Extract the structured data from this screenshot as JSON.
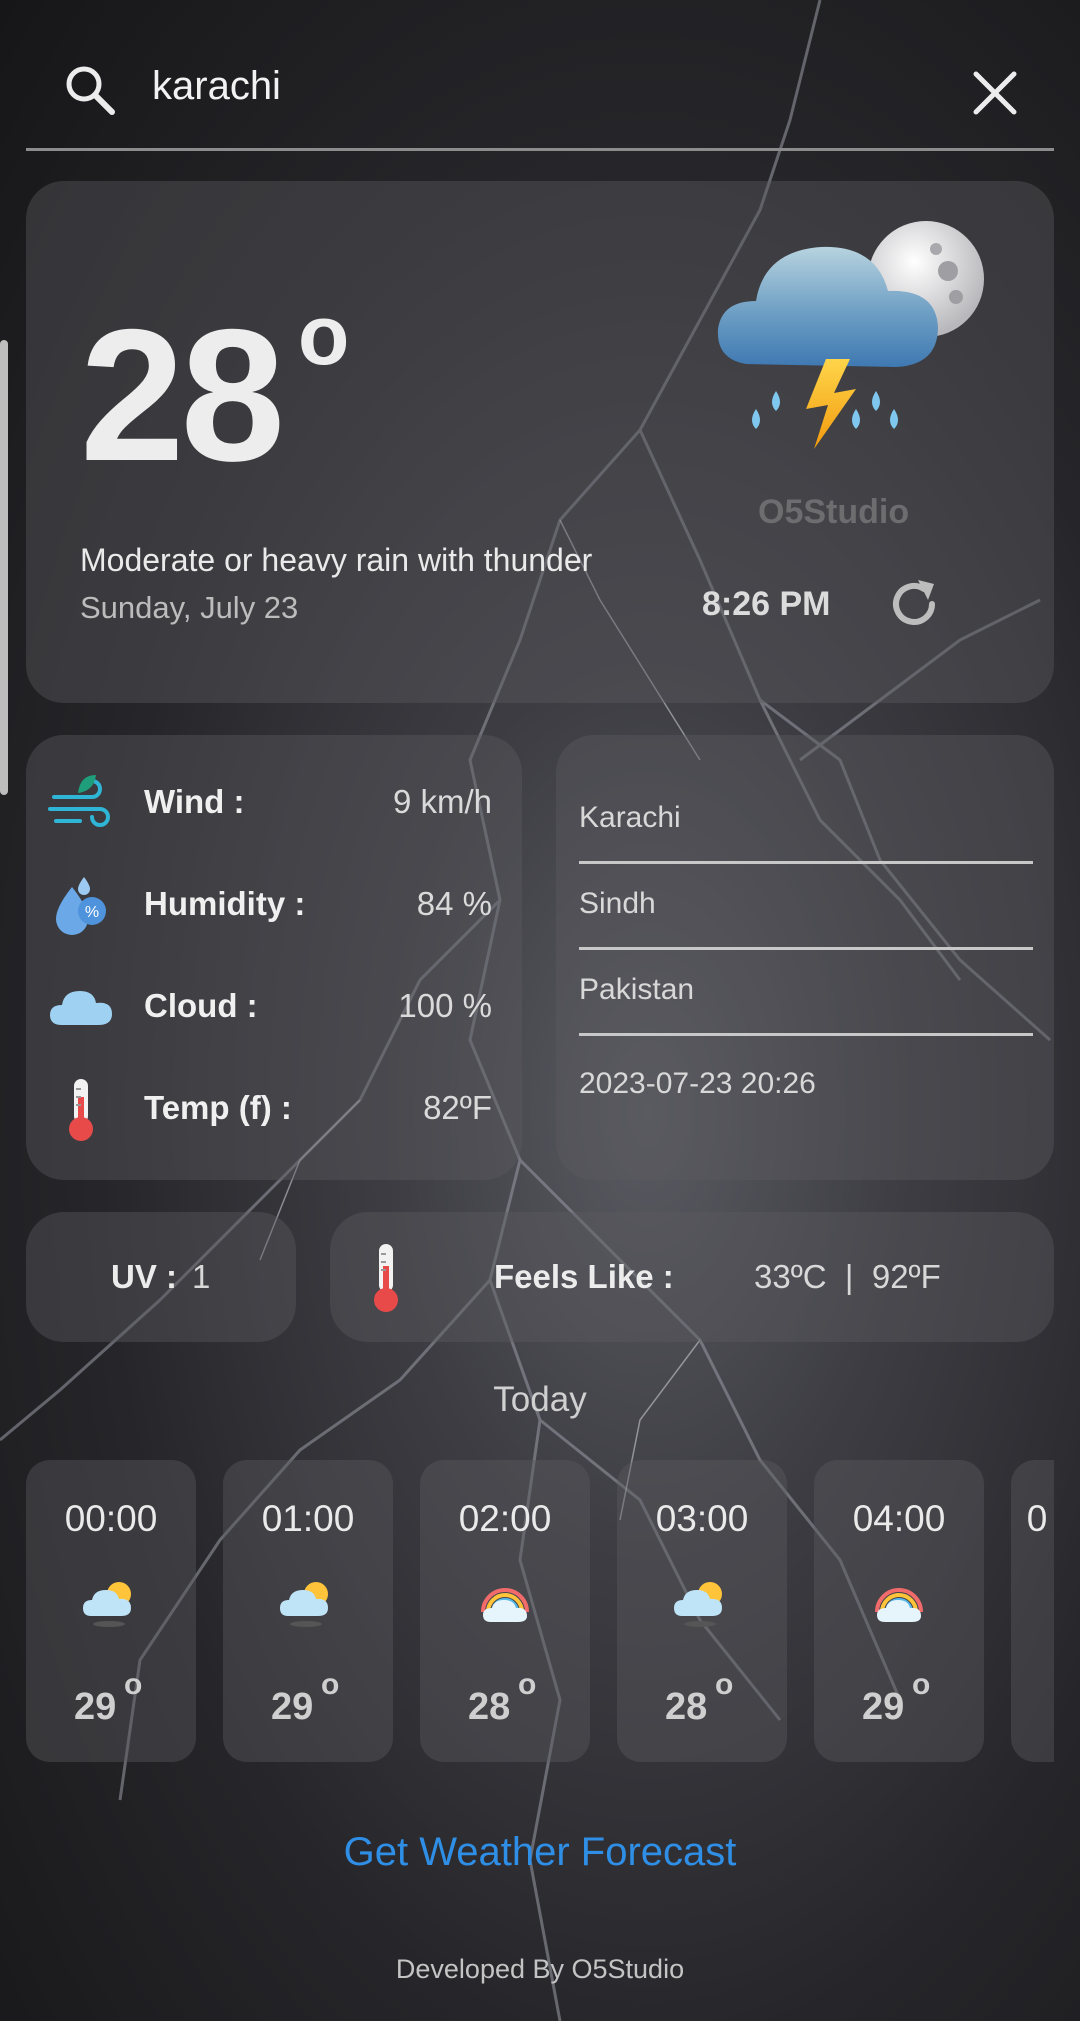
{
  "search": {
    "value": "karachi"
  },
  "current": {
    "temp": "28",
    "degree_symbol": "o",
    "condition": "Moderate or heavy rain with thunder",
    "date": "Sunday, July 23",
    "watermark": "O5Studio",
    "time": "8:26 PM",
    "icon": "thunder-rain-night-icon"
  },
  "stats": [
    {
      "label": "Wind  :",
      "value": "9 km/h",
      "icon": "wind-icon"
    },
    {
      "label": "Humidity :",
      "value": "84 %",
      "icon": "humidity-icon"
    },
    {
      "label": "Cloud :",
      "value": "100 %",
      "icon": "cloud-icon"
    },
    {
      "label": "Temp (f) :",
      "value": "82ºF",
      "icon": "thermometer-icon"
    }
  ],
  "location": {
    "city": "Karachi",
    "region": "Sindh",
    "country": "Pakistan",
    "datetime": "2023-07-23 20:26"
  },
  "uv": {
    "label": "UV :",
    "value": "1"
  },
  "feels_like": {
    "label": "Feels Like :",
    "value": "33ºC  |  92ºF"
  },
  "today_title": "Today",
  "hourly": [
    {
      "time": "00:00",
      "temp": "29",
      "deg": "o",
      "icon": "partly-cloudy-icon"
    },
    {
      "time": "01:00",
      "temp": "29",
      "deg": "o",
      "icon": "partly-cloudy-icon"
    },
    {
      "time": "02:00",
      "temp": "28",
      "deg": "o",
      "icon": "cloud-rainbow-icon"
    },
    {
      "time": "03:00",
      "temp": "28",
      "deg": "o",
      "icon": "partly-cloudy-icon"
    },
    {
      "time": "04:00",
      "temp": "29",
      "deg": "o",
      "icon": "cloud-rainbow-icon"
    },
    {
      "time": "0",
      "temp": "",
      "deg": "",
      "icon": ""
    }
  ],
  "forecast_link": "Get Weather Forecast",
  "footer": "Developed By O5Studio",
  "colors": {
    "accent": "#2f8fe6",
    "card": "#5a5a5f"
  }
}
